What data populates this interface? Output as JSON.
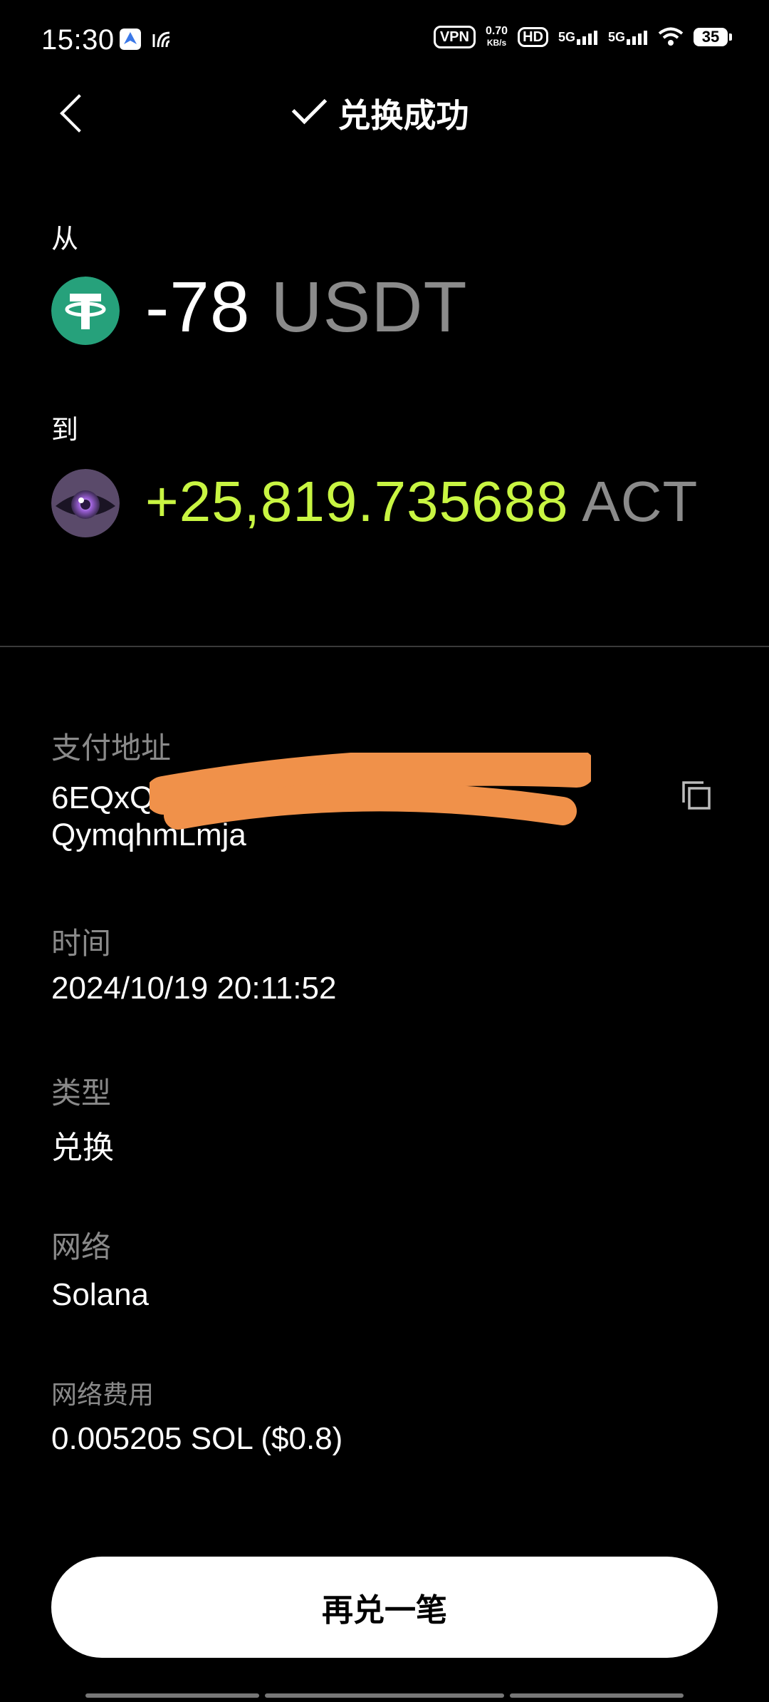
{
  "status_bar": {
    "time": "15:30",
    "vpn": "VPN",
    "speed_value": "0.70",
    "speed_unit": "KB/s",
    "hd": "HD",
    "net1": "5G",
    "net2": "5G",
    "battery": "35"
  },
  "header": {
    "title": "兑换成功"
  },
  "from": {
    "label": "从",
    "amount": "-78",
    "unit": "USDT",
    "icon": "tether-usdt-icon"
  },
  "to": {
    "label": "到",
    "amount": "+25,819.735688",
    "unit": "ACT",
    "icon": "act-token-icon"
  },
  "details": {
    "address_label": "支付地址",
    "address_line1": "6EQxQ",
    "address_line2": "QymqhmLmja",
    "time_label": "时间",
    "time_value": "2024/10/19 20:11:52",
    "type_label": "类型",
    "type_value": "兑换",
    "network_label": "网络",
    "network_value": "Solana",
    "fee_label": "网络费用",
    "fee_value": "0.005205 SOL ($0.8)"
  },
  "actions": {
    "repeat_label": "再兑一笔"
  },
  "colors": {
    "positive": "#c8f542",
    "muted": "#8a8a8a",
    "tether": "#26a17b",
    "redaction": "#f0914a"
  }
}
